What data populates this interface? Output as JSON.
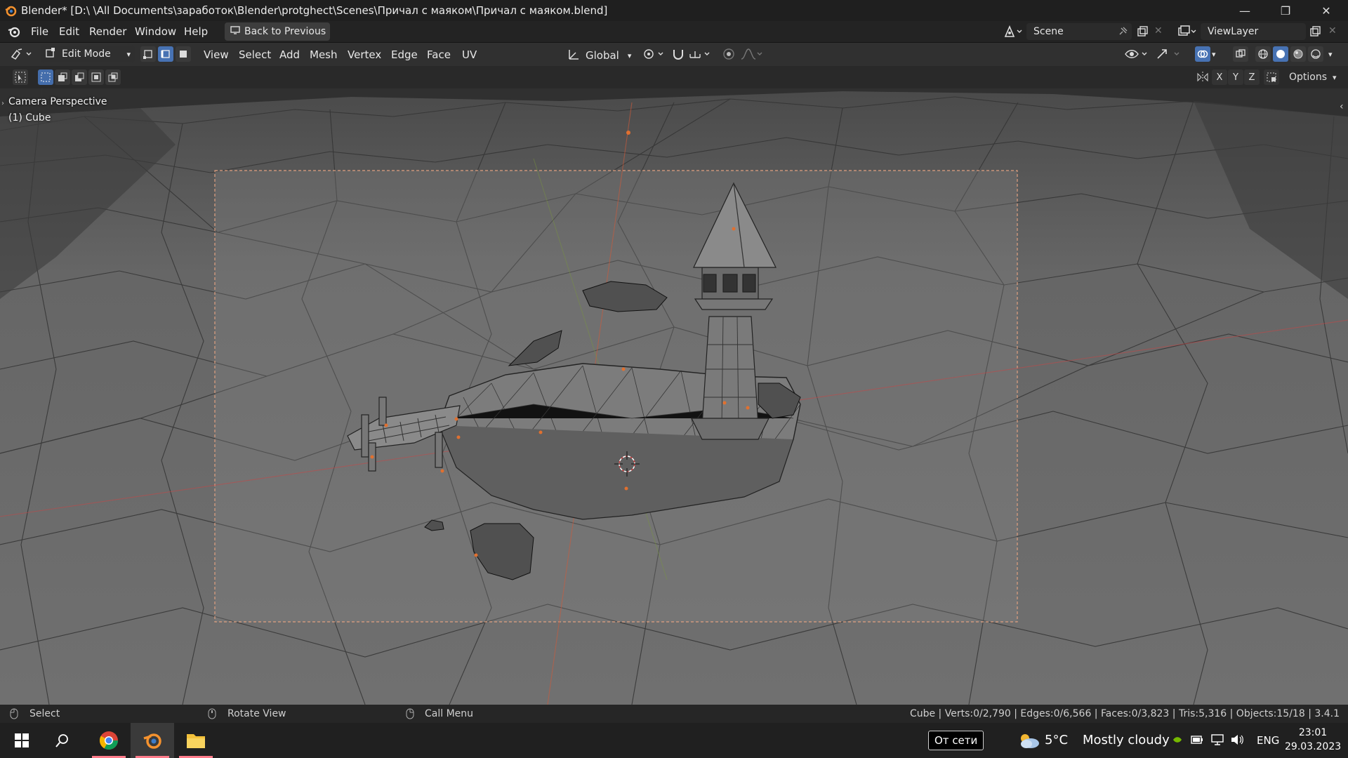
{
  "window": {
    "title": "Blender* [D:\\ \\All Documents\\заработок\\Blender\\protghect\\Scenes\\Причал с маяком\\Причал с маяком.blend]",
    "minimize": "—",
    "restore": "❐",
    "close": "✕"
  },
  "menu": {
    "items": [
      "File",
      "Edit",
      "Render",
      "Window",
      "Help"
    ],
    "back_button": "Back to Previous",
    "scene_label": "Scene",
    "viewlayer_label": "ViewLayer"
  },
  "header": {
    "mode": "Edit Mode",
    "menus": [
      "View",
      "Select",
      "Add",
      "Mesh",
      "Vertex",
      "Edge",
      "Face",
      "UV"
    ],
    "transform_orientation": "Global",
    "axis_x": "X",
    "axis_y": "Y",
    "axis_z": "Z",
    "options": "Options"
  },
  "viewport": {
    "overlay_line1": "Camera Perspective",
    "overlay_line2": "(1) Cube"
  },
  "statusbar": {
    "select": "Select",
    "rotate": "Rotate View",
    "call_menu": "Call Menu",
    "stats": "Cube | Verts:0/2,790 | Edges:0/6,566 | Faces:0/3,823 | Tris:5,316 | Objects:15/18 | 3.4.1"
  },
  "taskbar": {
    "network": "От сети",
    "weather_temp": "5°C",
    "weather_desc": "Mostly cloudy",
    "lang": "ENG",
    "time": "23:01",
    "date": "29.03.2023"
  },
  "colors": {
    "accent": "#4772b3",
    "camera_frame": "#e0a080",
    "xaxis": "#c84646",
    "yaxis": "#7a9a3a"
  }
}
